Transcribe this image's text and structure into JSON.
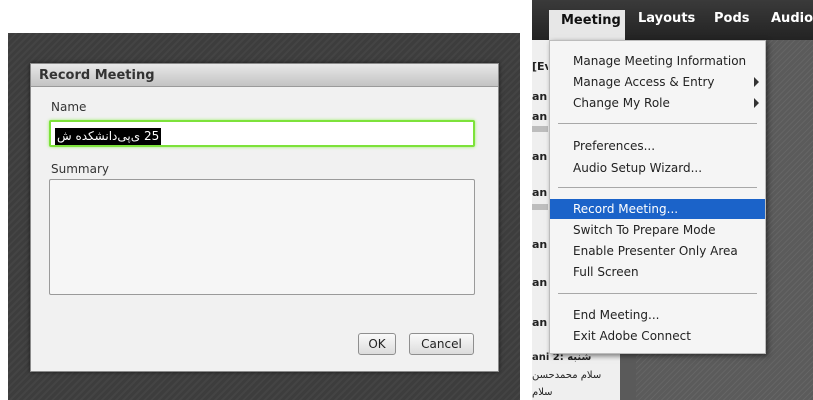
{
  "dialog": {
    "title": "Record Meeting",
    "name_label": "Name",
    "name_value": "25 ی‌پی‌دانشکده ش",
    "summary_label": "Summary",
    "summary_value": "",
    "ok_label": "OK",
    "cancel_label": "Cancel"
  },
  "menubar": {
    "items": [
      {
        "label": "Meeting"
      },
      {
        "label": "Layouts"
      },
      {
        "label": "Pods"
      },
      {
        "label": "Audio"
      }
    ]
  },
  "meeting_menu": {
    "items": [
      {
        "label": "Manage Meeting Information"
      },
      {
        "label": "Manage Access & Entry"
      },
      {
        "label": "Change My Role"
      },
      {
        "label": "Preferences..."
      },
      {
        "label": "Audio Setup Wizard..."
      },
      {
        "label": "Record Meeting..."
      },
      {
        "label": "Switch To Prepare Mode"
      },
      {
        "label": "Enable Presenter Only Area"
      },
      {
        "label": "Full Screen"
      },
      {
        "label": "End Meeting..."
      },
      {
        "label": "Exit Adobe Connect"
      }
    ]
  },
  "side_panel": {
    "items": [
      "[Ev",
      "an",
      "an",
      "an",
      "an",
      "an",
      "ani",
      "ani"
    ],
    "bottom": [
      "ani 2: شنبه",
      "سلام محمدحسن",
      "سلام"
    ]
  },
  "colors": {
    "focus_border": "#7de23a",
    "menu_highlight": "#1b63c9"
  }
}
